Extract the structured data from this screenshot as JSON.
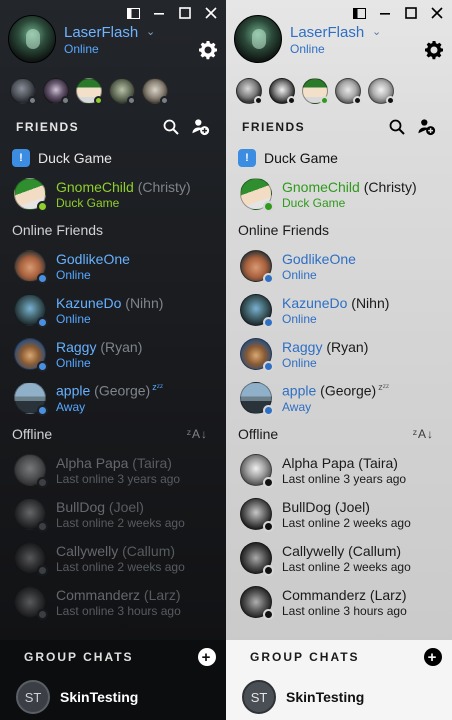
{
  "window": {
    "snap": "▭",
    "minimize": "—",
    "maximize": "☐",
    "close": "✕"
  },
  "profile": {
    "username": "LaserFlash",
    "status": "Online",
    "caret": "⌄"
  },
  "friends_bar": {
    "label": "FRIENDS"
  },
  "game_group": {
    "icon_letter": "!",
    "title": "Duck Game",
    "friend": {
      "name": "GnomeChild",
      "nick": "(Christy)",
      "sub": "Duck Game"
    }
  },
  "online_section": {
    "title": "Online Friends"
  },
  "online_friends": [
    {
      "name": "GodlikeOne",
      "nick": "",
      "sub": "Online"
    },
    {
      "name": "KazuneDo",
      "nick": "(Nihn)",
      "sub": "Online"
    },
    {
      "name": "Raggy",
      "nick": "(Ryan)",
      "sub": "Online"
    },
    {
      "name": "apple",
      "nick": "(George)",
      "zzz": "zᶻᶻ",
      "sub": "Away"
    }
  ],
  "offline_section": {
    "title": "Offline",
    "sort_icon": "ᶻA↓"
  },
  "offline_friends": [
    {
      "name": "Alpha Papa",
      "nick": "(Taira)",
      "sub": "Last online 3 years ago"
    },
    {
      "name": "BullDog",
      "nick": "(Joel)",
      "sub": "Last online 2 weeks ago"
    },
    {
      "name": "Callywelly",
      "nick": "(Callum)",
      "sub": "Last online 2 weeks ago"
    },
    {
      "name": "Commanderz",
      "nick": "(Larz)",
      "sub": "Last online 3 hours ago"
    }
  ],
  "group_chats": {
    "label": "GROUP CHATS",
    "add_icon": "+",
    "items": [
      {
        "initials": "ST",
        "name": "SkinTesting"
      }
    ]
  },
  "colors": {
    "dark_online": "#67b1ff",
    "dark_ingame": "#8fcf2b",
    "light_online": "#2f6fc4",
    "light_ingame": "#2f9a1c",
    "game_icon": "#3c8de2"
  }
}
